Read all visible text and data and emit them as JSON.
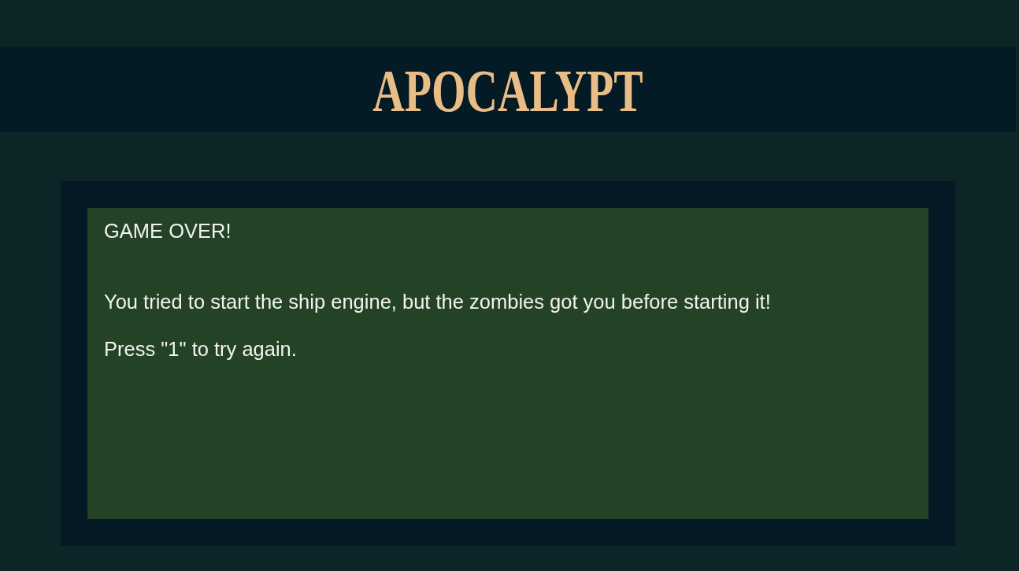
{
  "header": {
    "logo": "APOCALYPT"
  },
  "game_screen": {
    "heading": "GAME OVER!",
    "paragraphs": [
      "You tried to start the ship engine, but the zombies got you before starting it!",
      "Press \"1\" to try again."
    ]
  }
}
